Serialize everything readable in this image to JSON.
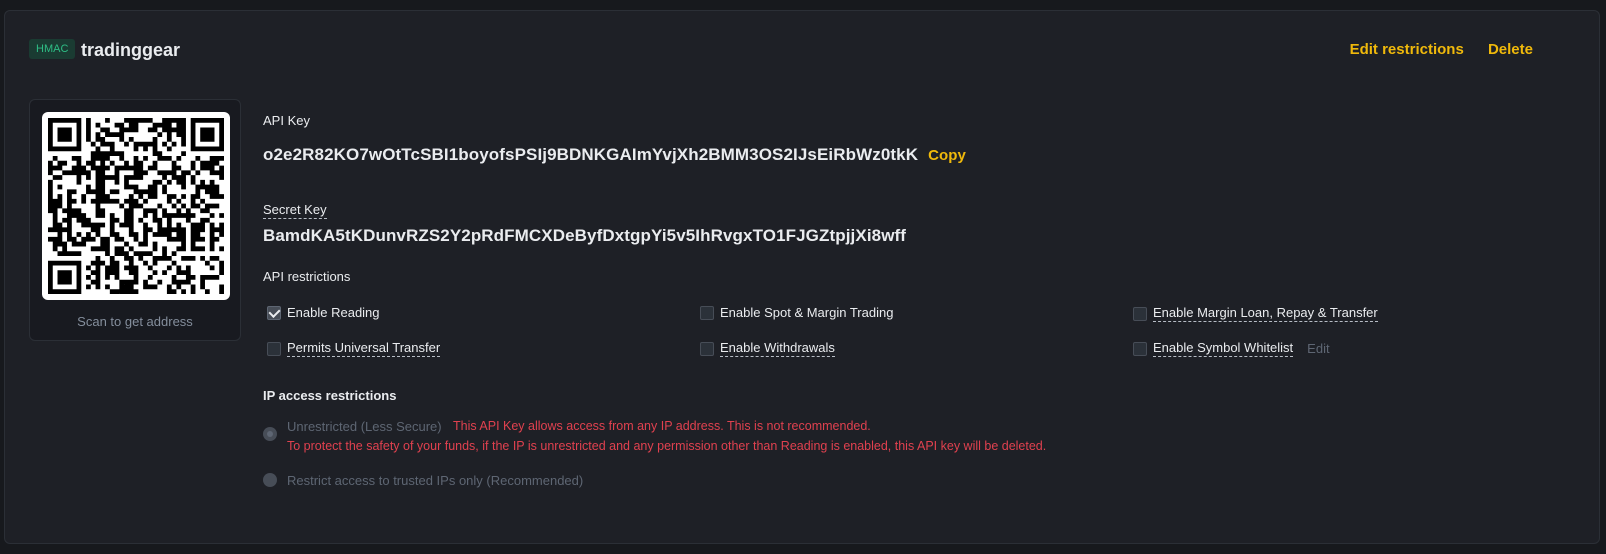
{
  "header": {
    "badge": "HMAC",
    "name": "tradinggear",
    "edit_restrictions": "Edit restrictions",
    "delete": "Delete"
  },
  "qr": {
    "caption": "Scan to get address"
  },
  "api_key": {
    "label": "API Key",
    "value": "o2e2R82KO7wOtTcSBI1boyofsPSIj9BDNKGAImYvjXh2BMM3OS2IJsEiRbWz0tkK",
    "copy": "Copy"
  },
  "secret_key": {
    "label": "Secret Key",
    "value": "BamdKA5tKDunvRZS2Y2pRdFMCXDeByfDxtgpYi5v5IhRvgxTO1FJGZtpjjXi8wff"
  },
  "restrictions": {
    "title": "API restrictions",
    "items": [
      {
        "label": "Enable Reading",
        "checked": true
      },
      {
        "label": "Enable Spot & Margin Trading",
        "checked": false
      },
      {
        "label": "Enable Margin Loan, Repay & Transfer",
        "checked": false
      },
      {
        "label": "Permits Universal Transfer",
        "checked": false
      },
      {
        "label": "Enable Withdrawals",
        "checked": false
      },
      {
        "label": "Enable Symbol Whitelist",
        "checked": false
      }
    ],
    "whitelist_edit": "Edit"
  },
  "ip": {
    "title": "IP access restrictions",
    "unrestricted_label": "Unrestricted (Less Secure)",
    "warning_line1": "This API Key allows access from any IP address. This is not recommended.",
    "warning_line2": "To protect the safety of your funds, if the IP is unrestricted and any permission other than Reading is enabled, this API key will be deleted.",
    "restricted_label": "Restrict access to trusted IPs only (Recommended)",
    "selected": "unrestricted"
  },
  "colors": {
    "accent": "#f0b90b",
    "warning": "#e0414f",
    "badge": "#2ebd85"
  }
}
